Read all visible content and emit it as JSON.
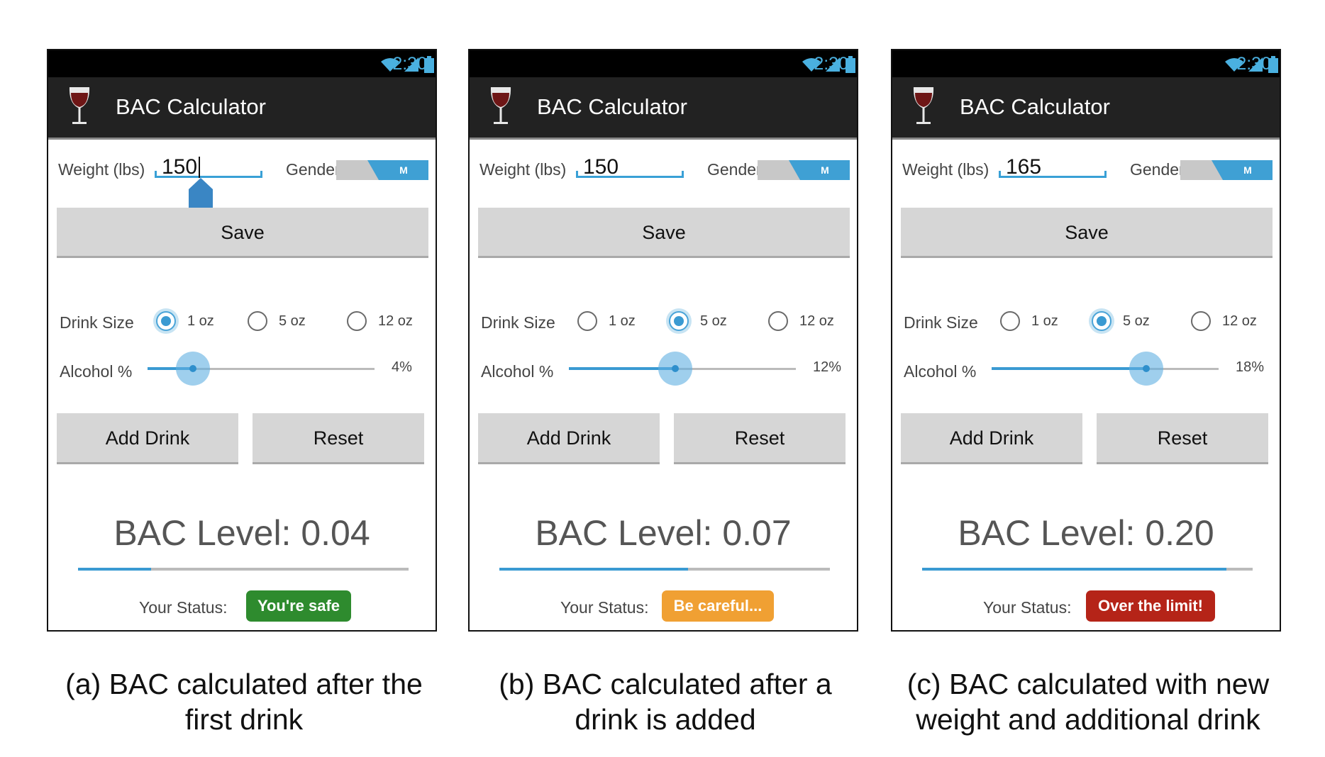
{
  "panels": [
    {
      "status_time": "2:30",
      "app_title": "BAC Calculator",
      "weight_label": "Weight (lbs)",
      "weight_value": "150",
      "gender_label": "Gender",
      "gender_value": "M",
      "save_label": "Save",
      "drink_size_label": "Drink Size",
      "drink_sizes": [
        "1 oz",
        "5 oz",
        "12 oz"
      ],
      "selected_drink_size": "1 oz",
      "alcohol_label": "Alcohol %",
      "alcohol_value": "4%",
      "alcohol_fraction": 0.2,
      "add_drink_label": "Add Drink",
      "reset_label": "Reset",
      "bac_text": "BAC Level: 0.04",
      "bac_progress": 0.22,
      "status_label": "Your Status:",
      "status_text": "You're safe",
      "status_color": "#2e8b2e",
      "caption_line1": "(a) BAC calculated after the",
      "caption_line2": "first drink"
    },
    {
      "status_time": "2:30",
      "app_title": "BAC Calculator",
      "weight_label": "Weight (lbs)",
      "weight_value": "150",
      "gender_label": "Gender",
      "gender_value": "M",
      "save_label": "Save",
      "drink_size_label": "Drink Size",
      "drink_sizes": [
        "1 oz",
        "5 oz",
        "12 oz"
      ],
      "selected_drink_size": "5 oz",
      "alcohol_label": "Alcohol %",
      "alcohol_value": "12%",
      "alcohol_fraction": 0.47,
      "add_drink_label": "Add Drink",
      "reset_label": "Reset",
      "bac_text": "BAC Level: 0.07",
      "bac_progress": 0.57,
      "status_label": "Your Status:",
      "status_text": "Be careful...",
      "status_color": "#f0a033",
      "caption_line1": "(b) BAC calculated after a",
      "caption_line2": "drink is added"
    },
    {
      "status_time": "2:30",
      "app_title": "BAC Calculator",
      "weight_label": "Weight (lbs)",
      "weight_value": "165",
      "gender_label": "Gender",
      "gender_value": "M",
      "save_label": "Save",
      "drink_size_label": "Drink Size",
      "drink_sizes": [
        "1 oz",
        "5 oz",
        "12 oz"
      ],
      "selected_drink_size": "5 oz",
      "alcohol_label": "Alcohol %",
      "alcohol_value": "18%",
      "alcohol_fraction": 0.68,
      "add_drink_label": "Add Drink",
      "reset_label": "Reset",
      "bac_text": "BAC Level: 0.20",
      "bac_progress": 0.92,
      "status_label": "Your Status:",
      "status_text": "Over the limit!",
      "status_color": "#b52418",
      "caption_line1": "(c) BAC calculated with new",
      "caption_line2": "weight and additional drink"
    }
  ],
  "icons": [
    "wifi-icon",
    "signal-icon",
    "battery-icon",
    "wine-glass-icon",
    "text-cursor-handle-icon"
  ],
  "colors": {
    "accent": "#3a9ad2",
    "appbar": "#222222",
    "button": "#d6d6d6"
  }
}
